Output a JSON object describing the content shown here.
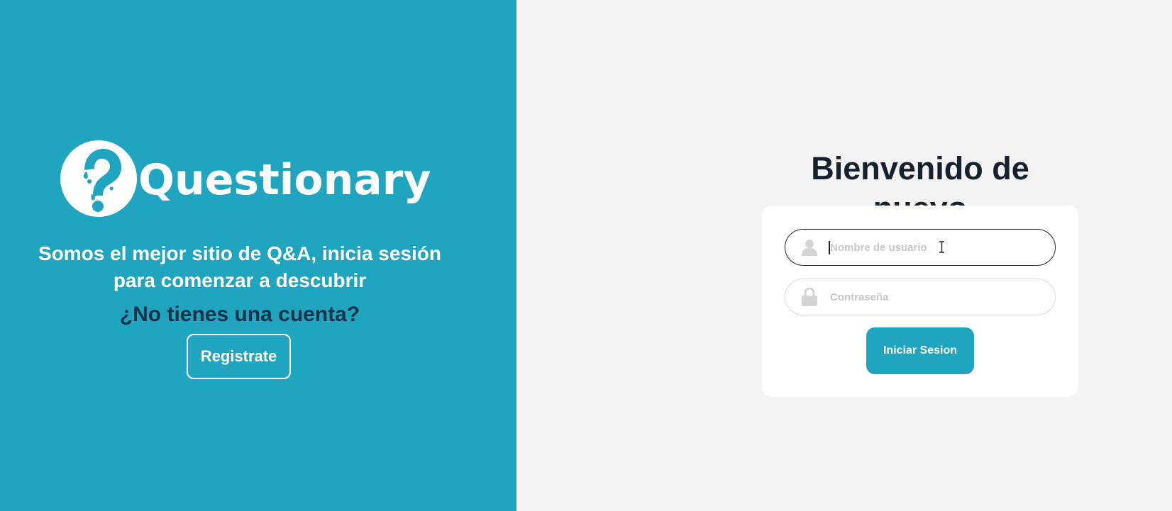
{
  "brand": {
    "name": "Questionary",
    "logo_icon": "question-mark-icon"
  },
  "left_panel": {
    "tagline_line1": "Somos el mejor sitio de Q&A, inicia sesión",
    "tagline_line2": "para comenzar a descubrir",
    "question": "¿No tienes una cuenta?",
    "register_label": "Registrate",
    "background_color": "#20a5c0"
  },
  "login": {
    "title": "Bienvenido de nuevo",
    "username": {
      "placeholder": "Nombre de usuario",
      "value": "",
      "icon": "user-icon"
    },
    "password": {
      "placeholder": "Contraseña",
      "value": "",
      "icon": "lock-icon"
    },
    "submit_label": "Iniciar Sesion"
  },
  "colors": {
    "accent": "#20a5c0",
    "dark_text": "#17202d",
    "question_text": "#17324a",
    "right_background": "#f3f3f3"
  }
}
